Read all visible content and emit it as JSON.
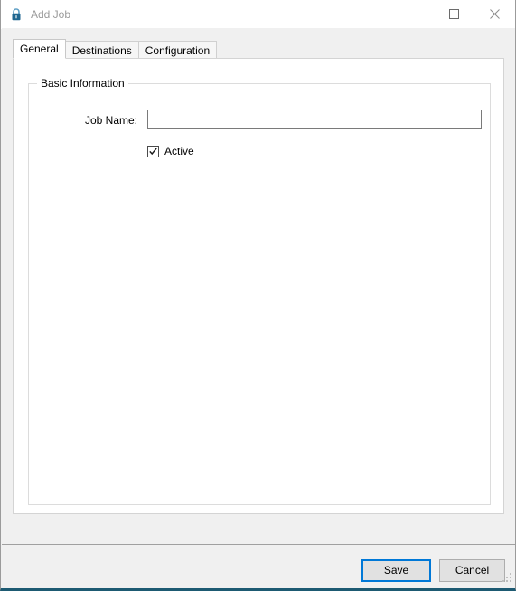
{
  "window": {
    "title": "Add Job",
    "icon": "lock-icon",
    "controls": {
      "minimize": "Minimize",
      "maximize": "Maximize",
      "close": "Close"
    },
    "accent_color": "#0078d7",
    "bottom_border_color": "#1d5a72"
  },
  "tabs": [
    {
      "label": "General",
      "selected": true
    },
    {
      "label": "Destinations",
      "selected": false
    },
    {
      "label": "Configuration",
      "selected": false
    }
  ],
  "general_tab": {
    "group": {
      "legend": "Basic Information",
      "job_name": {
        "label": "Job Name:",
        "value": "",
        "placeholder": ""
      },
      "active": {
        "label": "Active",
        "checked": true
      }
    }
  },
  "footer": {
    "save_label": "Save",
    "cancel_label": "Cancel"
  }
}
